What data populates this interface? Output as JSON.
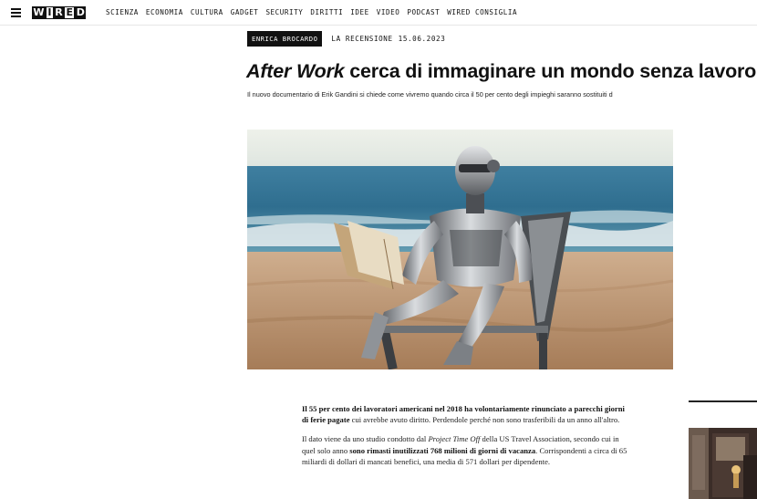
{
  "nav": {
    "logo_letters": [
      "W",
      "I",
      "R",
      "E",
      "D"
    ],
    "links": [
      "SCIENZA",
      "ECONOMIA",
      "CULTURA",
      "GADGET",
      "SECURITY",
      "DIRITTI",
      "IDEE",
      "VIDEO",
      "PODCAST",
      "WIRED CONSIGLIA"
    ]
  },
  "article": {
    "author": "ENRICA BROCARDO",
    "section": "LA RECENSIONE",
    "date": "15.06.2023",
    "title_italic": "After Work",
    "title_rest": " cerca di immaginare un mondo senza lavoro",
    "dek": "Il nuovo documentario di Erik Gandini si chiede come vivremo quando circa il 50 per cento degli impieghi saranno sostituiti d",
    "hero_image": "robot-reading-book-on-beach-chair",
    "paragraphs": [
      {
        "bold1": "Il 55 per cento dei lavoratori americani nel 2018 ha volontariamente rinunciato a parecchi giorni di ferie pagate",
        "text1": " cui avrebbe avuto diritto. Perdendole perché non sono trasferibili da un anno all'altro."
      },
      {
        "text1": "Il dato viene da uno studio condotto dal ",
        "italic1": "Project Time Off",
        "text2": " della US Travel Association, secondo cui in quel solo anno ",
        "bold1": "sono rimasti inutilizzati 768 milioni di giorni di vacanza",
        "text3": ". Corrispondenti a circa di 65 miliardi di dollari di mancati benefici, una media di 571 dollari per dipendente."
      }
    ]
  },
  "icons": {
    "menu": "hamburger-menu-icon"
  }
}
